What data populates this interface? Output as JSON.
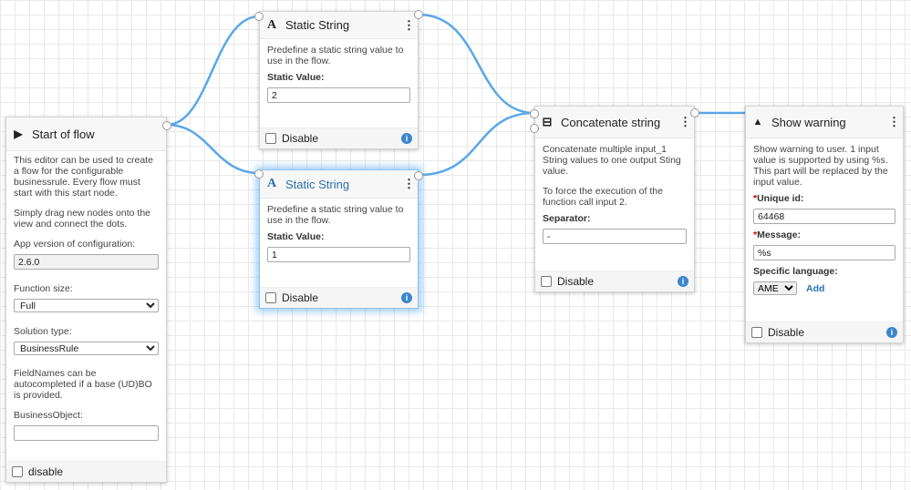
{
  "start_node": {
    "title": "Start of flow",
    "description1": "This editor can be used to create a flow for the configurable businessrule. Every flow must start with this start node.",
    "description2": "Simply drag new nodes onto the view and connect the dots.",
    "app_version_label": "App version of configuration:",
    "app_version_value": "2.6.0",
    "function_size_label": "Function size:",
    "function_size_value": "Full",
    "solution_type_label": "Solution type:",
    "solution_type_value": "BusinessRule",
    "fieldnames_note": "FieldNames can be autocompleted if a base (UD)BO is provided.",
    "business_object_label": "BusinessObject:",
    "business_object_value": "",
    "disable_label": "disable"
  },
  "static_string_1": {
    "icon": "A",
    "title": "Static String",
    "description": "Predefine a static string value to use in the flow.",
    "value_label": "Static Value:",
    "value": "2",
    "disable_label": "Disable"
  },
  "static_string_2": {
    "icon": "A",
    "title": "Static String",
    "description": "Predefine a static string value to use in the flow.",
    "value_label": "Static Value:",
    "value": "1",
    "disable_label": "Disable"
  },
  "concatenate": {
    "title": "Concatenate string",
    "description1": "Concatenate multiple input_1 String values to one output Sting value.",
    "description2": "To force the execution of the function call input 2.",
    "separator_label": "Separator:",
    "separator_value": "-",
    "disable_label": "Disable"
  },
  "show_warning": {
    "icon": "▲",
    "title": "Show warning",
    "description": "Show warning to user. 1 input value is supported by using %s. This part will be replaced by the input value.",
    "unique_id_label": "Unique id:",
    "unique_id_value": "64468",
    "message_label": "Message:",
    "message_value": "%s",
    "specific_language_label": "Specific language:",
    "language_value": "AME",
    "add_label": "Add",
    "disable_label": "Disable"
  },
  "common": {
    "required_marker": "*",
    "menu_glyph": "⋮",
    "info_glyph": "i",
    "play_glyph": "▶",
    "concat_glyph": "⊟"
  },
  "colors": {
    "wire": "#5aa7e6",
    "selected_glow": "#4aa0e8",
    "info_badge": "#3a86cc"
  }
}
